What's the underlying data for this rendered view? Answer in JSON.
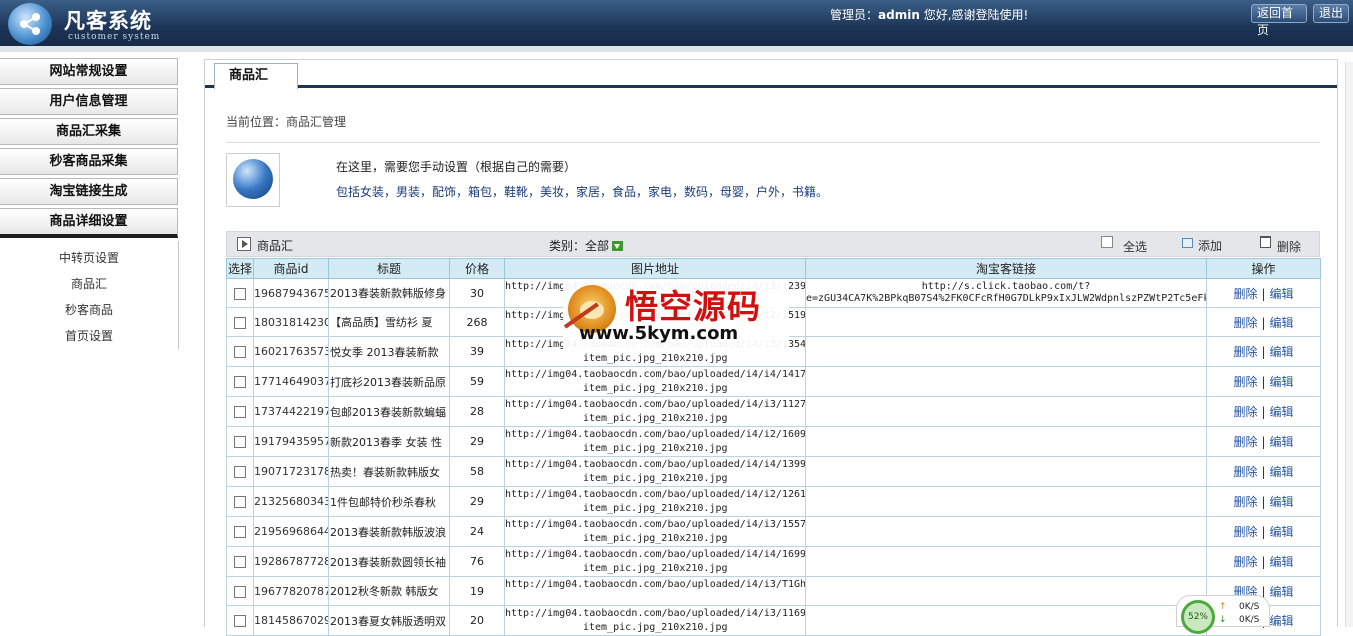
{
  "header": {
    "app_title": "凡客系统",
    "app_subtitle": "customer system",
    "admin_prefix": "管理员：",
    "admin_name": "admin",
    "admin_suffix": " 您好,感谢登陆使用!",
    "btn_home": "返回首页",
    "btn_logout": "退出"
  },
  "sidebar": {
    "items": [
      {
        "label": "网站常规设置"
      },
      {
        "label": "用户信息管理"
      },
      {
        "label": "商品汇采集"
      },
      {
        "label": "秒客商品采集"
      },
      {
        "label": "淘宝链接生成"
      },
      {
        "label": "商品详细设置"
      }
    ],
    "sub_items": [
      {
        "label": "中转页设置"
      },
      {
        "label": "商品汇"
      },
      {
        "label": "秒客商品"
      },
      {
        "label": "首页设置"
      }
    ]
  },
  "main": {
    "tab_label": "商品汇",
    "breadcrumb": "当前位置：商品汇管理",
    "info_line1": "在这里，需要您手动设置（根据自己的需要）",
    "info_line2": "包括女装，男装，配饰，箱包，鞋靴，美妆，家居，食品，家电，数码，母婴，户外，书籍。",
    "toolbar": {
      "title": "商品汇",
      "category_label": "类别：",
      "category_value": "全部",
      "select_all": "全选",
      "add": "添加",
      "delete": "删除"
    },
    "table": {
      "headers": [
        "选择",
        "商品id",
        "标题",
        "价格",
        "图片地址",
        "淘宝客链接",
        "操作"
      ],
      "ops_delete": "删除",
      "ops_sep": "|",
      "ops_edit": "编辑",
      "rows": [
        {
          "id": "19687943675",
          "title": "2013春装新款韩版修身",
          "price": "30",
          "img1": "http://img04.taobaocdn.com/bao/uploaded/i4/i3/1239",
          "img2": "",
          "link1": "http://s.click.taobao.com/t?",
          "link2": "e=zGU34CA7K%2BPkqB07S4%2FK0CFcRfH0G7DLkP9xIxJLW2WdpnlszPZWtP2Tc5eFk"
        },
        {
          "id": "18031814230",
          "title": "【高品质】雪纺衫 夏",
          "price": "268",
          "img1": "http://img04.taobaocdn.com/bao/uploaded/i4/i2/1519",
          "img2": "",
          "link1": "",
          "link2": ""
        },
        {
          "id": "16021763573",
          "title": "悦女季 2013春装新款",
          "price": "39",
          "img1": "http://img04.taobaocdn.com/bao/uploaded/i4/i3/1354",
          "img2": "item_pic.jpg_210x210.jpg",
          "link1": "",
          "link2": ""
        },
        {
          "id": "17714649037",
          "title": "打底衫2013春装新品原",
          "price": "59",
          "img1": "http://img04.taobaocdn.com/bao/uploaded/i4/i4/1417",
          "img2": "item_pic.jpg_210x210.jpg",
          "link1": "",
          "link2": ""
        },
        {
          "id": "17374422197",
          "title": "包邮2013春装新款蝙蝠",
          "price": "28",
          "img1": "http://img04.taobaocdn.com/bao/uploaded/i4/i3/1127",
          "img2": "item_pic.jpg_210x210.jpg",
          "link1": "",
          "link2": ""
        },
        {
          "id": "19179435957",
          "title": "新款2013春季 女装 性",
          "price": "29",
          "img1": "http://img04.taobaocdn.com/bao/uploaded/i4/i2/1609",
          "img2": "item_pic.jpg_210x210.jpg",
          "link1": "",
          "link2": ""
        },
        {
          "id": "19071723178",
          "title": "热卖！春装新款韩版女",
          "price": "58",
          "img1": "http://img04.taobaocdn.com/bao/uploaded/i4/i4/1399",
          "img2": "item_pic.jpg_210x210.jpg",
          "link1": "",
          "link2": ""
        },
        {
          "id": "21325680343",
          "title": "1件包邮特价秒杀春秋",
          "price": "29",
          "img1": "http://img04.taobaocdn.com/bao/uploaded/i4/i2/1261",
          "img2": "item_pic.jpg_210x210.jpg",
          "link1": "",
          "link2": ""
        },
        {
          "id": "21956968644",
          "title": "2013春装新款韩版波浪",
          "price": "24",
          "img1": "http://img04.taobaocdn.com/bao/uploaded/i4/i3/1557",
          "img2": "item_pic.jpg_210x210.jpg",
          "link1": "",
          "link2": ""
        },
        {
          "id": "19286787728",
          "title": "2013春装新款圆领长袖",
          "price": "76",
          "img1": "http://img04.taobaocdn.com/bao/uploaded/i4/i4/1699",
          "img2": "item_pic.jpg_210x210.jpg",
          "link1": "",
          "link2": ""
        },
        {
          "id": "19677820787",
          "title": "2012秋冬新款 韩版女",
          "price": "19",
          "img1": "http://img04.taobaocdn.com/bao/uploaded/i4/i3/T1Gh",
          "img2": "",
          "link1": "",
          "link2": ""
        },
        {
          "id": "18145867029",
          "title": "2013春夏女韩版透明双",
          "price": "20",
          "img1": "http://img04.taobaocdn.com/bao/uploaded/i4/i3/1169",
          "img2": "item_pic.jpg_210x210.jpg",
          "link1": "",
          "link2": ""
        }
      ]
    }
  },
  "watermark": {
    "brand": "悟空源码",
    "url": "www.5kym.com"
  },
  "net_meter": {
    "percent": "52%",
    "up_speed": "0K/S",
    "down_speed": "0K/S",
    "up_arrow": "↑",
    "down_arrow": "↓"
  },
  "colors": {
    "header_dark": "#1d3557",
    "table_header_bg": "#d3ebf4",
    "link_blue": "#2454a3",
    "watermark_red": "#d10f0f"
  }
}
